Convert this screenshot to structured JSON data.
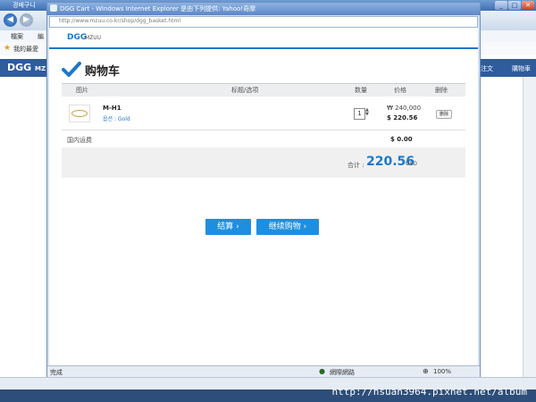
{
  "background": {
    "window_title": "경배구니",
    "menu_items": [
      "檔案",
      "編"
    ],
    "favorites_label": "我的最愛",
    "site_logo": "DGG",
    "site_logo_suffix": "MZ",
    "nav_right_1": "注文",
    "nav_right_2": "購物車",
    "taskbar_url": "http://hsuan3964.pixnet.net/album"
  },
  "popup": {
    "title": "DGG Cart - Windows Internet Explorer 是由下列提供: Yahoo!奇摩",
    "address": "http://www.mzuu.co.kr/shop/dgg_basket.html",
    "brand": "DGG",
    "brand_sub": "MZUU",
    "heading": "购物车",
    "columns": {
      "image": "图片",
      "title": "标题/选项",
      "qty": "数量",
      "price": "价格",
      "delete": "删除"
    },
    "item": {
      "name": "M-H1",
      "option": "옵션 : Gold",
      "qty": "1",
      "price_krw": "₩ 240,000",
      "price_usd": "$  220.56",
      "delete_label": "删除"
    },
    "shipping": {
      "label": "国内运费",
      "value": "$  0.00"
    },
    "total": {
      "label": "合计 :",
      "value": "220.56",
      "currency": "USD"
    },
    "buttons": {
      "checkout": "结算  ›",
      "continue": "继续购物  ›"
    },
    "status": {
      "left": "完成",
      "zone": "網際網路",
      "zoom": "100%"
    },
    "colors": {
      "accent": "#1d78c8",
      "button": "#1e8fe0"
    }
  }
}
